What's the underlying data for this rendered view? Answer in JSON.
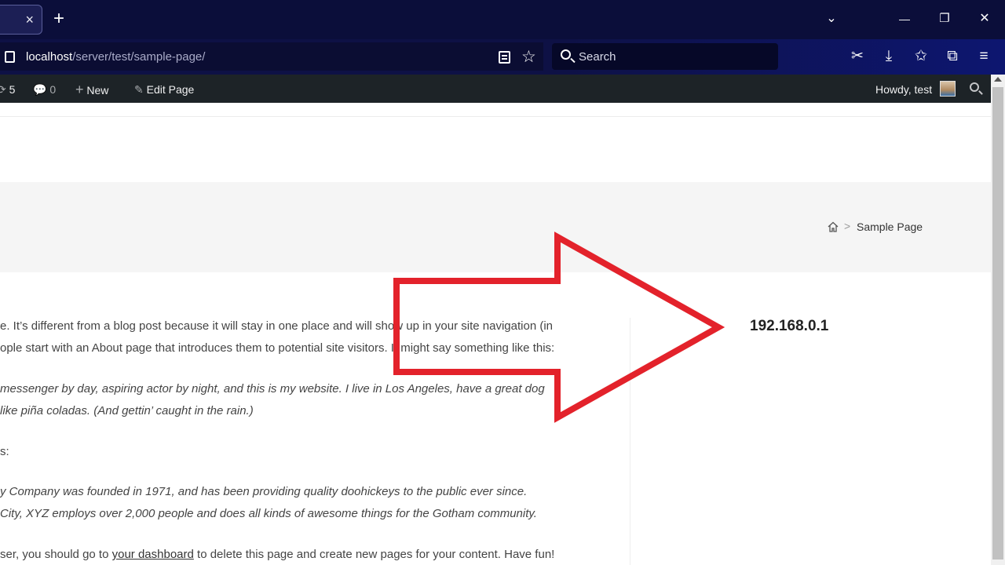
{
  "browser": {
    "tab": {
      "close_glyph": "×"
    },
    "new_tab_glyph": "+",
    "window_controls": {
      "minimize": "—",
      "restore": "❐",
      "close": "✕",
      "list": "⌄"
    },
    "url": {
      "host": "localhost",
      "path": "/server/test/sample-page/"
    },
    "search_placeholder": "Search",
    "icons": [
      "reader-view-icon",
      "bookmark-star-icon",
      "search-icon",
      "screenshot-icon",
      "downloads-icon",
      "bookmarks-icon",
      "extensions-icon",
      "menu-icon"
    ]
  },
  "adminbar": {
    "updates_count": "5",
    "comments_count": "0",
    "new_label": "New",
    "edit_label": "Edit Page",
    "greeting": "Howdy, test"
  },
  "breadcrumb": {
    "separator": ">",
    "current": "Sample Page"
  },
  "content": {
    "lines": [
      {
        "text": "e. It’s different from a blog post because it will stay in one place and will show up in your site navigation (in",
        "italic": false
      },
      {
        "text": "ople start with an About page that introduces them to potential site visitors. It might say something like this:",
        "italic": false
      },
      {
        "text": " messenger by day, aspiring actor by night, and this is my website. I live in Los Angeles, have a great dog",
        "italic": true
      },
      {
        "text": " like piña coladas. (And gettin’ caught in the rain.)",
        "italic": true
      },
      {
        "text": "s:",
        "italic": false
      },
      {
        "text": "y Company was founded in 1971, and has been providing quality doohickeys to the public ever since.",
        "italic": true
      },
      {
        "text": " City, XYZ employs over 2,000 people and does all kinds of awesome things for the Gotham community.",
        "italic": true
      }
    ],
    "last_line": {
      "before": "ser, you should go to ",
      "link": "your dashboard",
      "after": " to delete this page and create new pages for your content. Have fun!"
    }
  },
  "sidebar": {
    "ip": "192.168.0.1"
  },
  "annotation": {
    "arrow_color": "#e3222b"
  }
}
